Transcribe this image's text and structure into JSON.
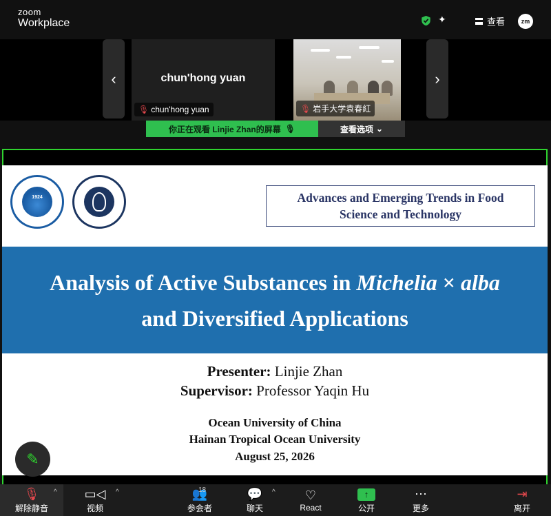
{
  "app": {
    "logo_line1": "zoom",
    "logo_line2": "Workplace",
    "view_label": "查看",
    "avatar_initials": "zm"
  },
  "participants": [
    {
      "tile_name": "chun'hong yuan",
      "tag": "chun'hong yuan"
    },
    {
      "tile_name": "",
      "tag": "岩手大学袁春紅"
    }
  ],
  "share_bar": {
    "viewing": "你正在观看 Linjie Zhan的屏幕",
    "options": "查看选项"
  },
  "slide": {
    "box_line1": "Advances and Emerging Trends in Food",
    "box_line2": "Science and Technology",
    "title_line1_a": "Analysis of Active Substances in ",
    "title_line1_b": "Michelia",
    "title_line1_c": " × ",
    "title_line1_d": "alba",
    "title_line2": "and Diversified Applications",
    "presenter_label": "Presenter:",
    "presenter_name": "Linjie Zhan",
    "supervisor_label": "Supervisor:",
    "supervisor_name": "Professor Yaqin Hu",
    "inst1": "Ocean University of China",
    "inst2": "Hainan Tropical Ocean University",
    "date": "August 25, 2026",
    "seal1_text": "1924"
  },
  "toolbar": {
    "unmute": "解除静音",
    "video": "视频",
    "participants": "参会者",
    "participant_count": "18",
    "chat": "聊天",
    "react": "React",
    "share": "公开",
    "more": "更多",
    "leave": "离开"
  },
  "colors": {
    "accent_green": "#2fd32f",
    "banner_blue": "#1f6fae",
    "mic_off_red": "#e5484d"
  }
}
